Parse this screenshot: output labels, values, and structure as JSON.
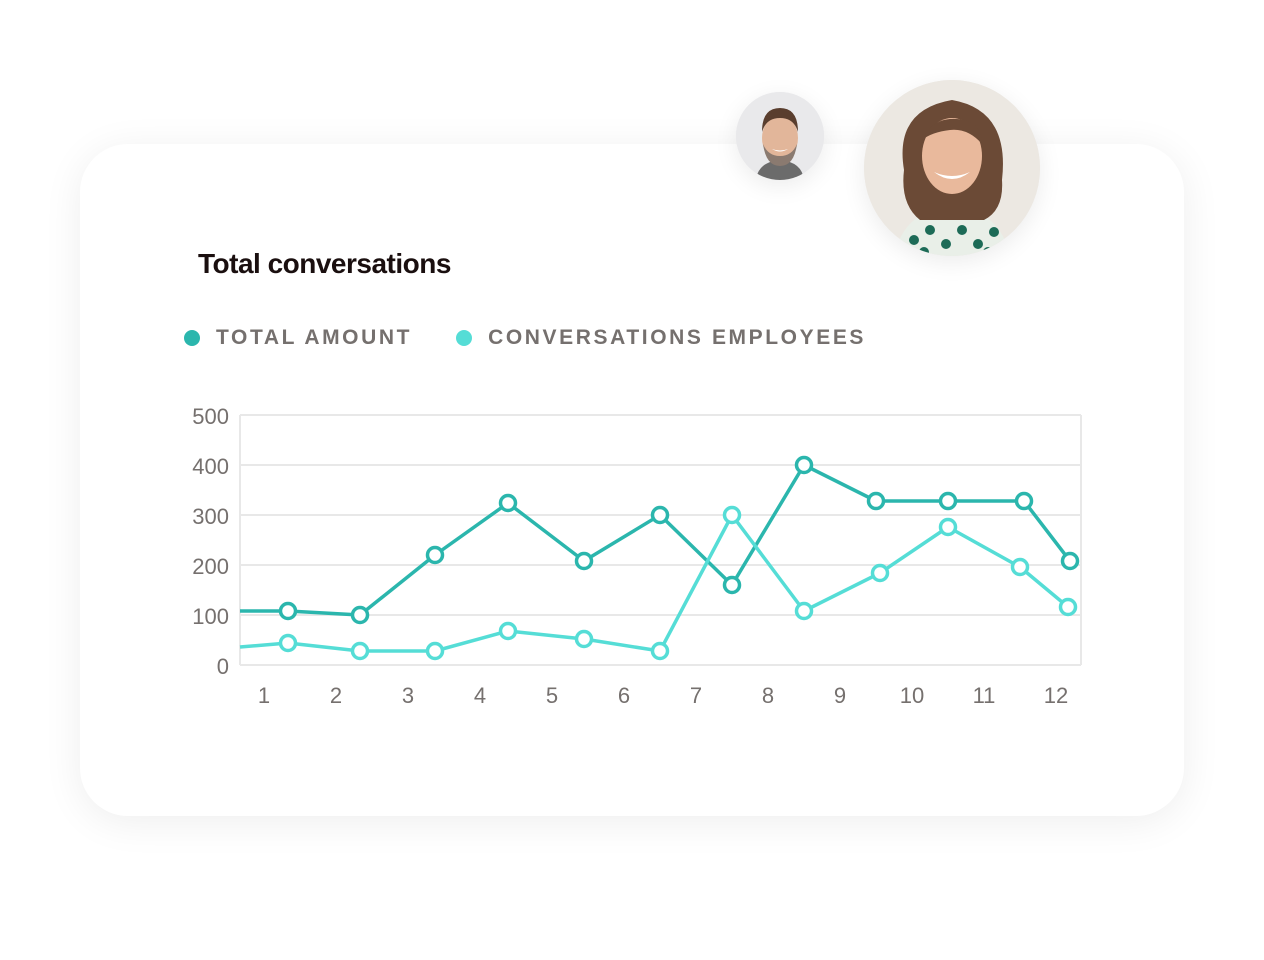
{
  "card": {
    "title": "Total conversations"
  },
  "avatars": [
    {
      "name": "man-avatar",
      "description": "Smiling bearded man"
    },
    {
      "name": "woman-avatar",
      "description": "Smiling woman with curly hair"
    }
  ],
  "colors": {
    "total_amount": "#2bb6ad",
    "conversations_employees": "#55ddd6",
    "grid": "#e8e8e8",
    "tick_text": "#75706e",
    "title_text": "#1a0f0f"
  },
  "chart_data": {
    "type": "line",
    "title": "Total conversations",
    "xlabel": "",
    "ylabel": "",
    "categories": [
      "1",
      "2",
      "3",
      "4",
      "5",
      "6",
      "7",
      "8",
      "9",
      "10",
      "11",
      "12"
    ],
    "yticks": [
      0,
      100,
      200,
      300,
      400,
      500
    ],
    "ylim": [
      0,
      500
    ],
    "grid": true,
    "legend_position": "top-left",
    "series": [
      {
        "name": "TOTAL AMOUNT",
        "start_value": 108,
        "values": [
          108,
          100,
          220,
          324,
          208,
          300,
          160,
          400,
          328,
          328,
          328,
          208
        ]
      },
      {
        "name": "CONVERSATIONS EMPLOYEES",
        "start_value": 36,
        "values": [
          44,
          28,
          28,
          68,
          52,
          28,
          300,
          108,
          184,
          276,
          196,
          116
        ]
      }
    ]
  }
}
